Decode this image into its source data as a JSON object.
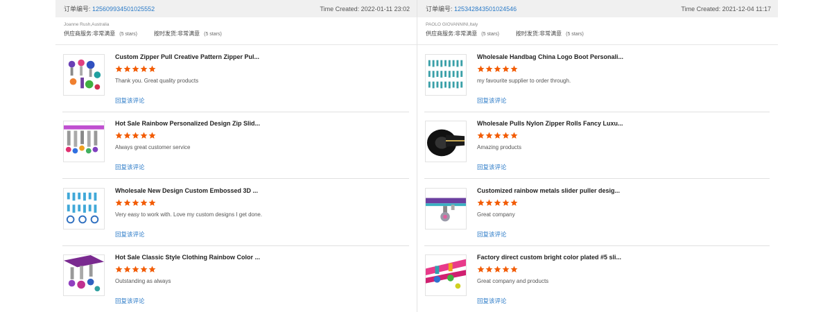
{
  "orders": [
    {
      "id_label": "订单编号:",
      "id": "125609934501025552",
      "time_created": "Time Created: 2022-01-11 23:02",
      "buyer": "Joanne Rush,Australia",
      "ratings": [
        {
          "label": "供应商服务:",
          "value": "非常满意",
          "stars": "(5 stars)"
        },
        {
          "label": "按时发货:",
          "value": "非常满意",
          "stars": "(5 stars)"
        }
      ],
      "reviews": [
        {
          "title": "Custom Zipper Pull Creative Pattern Zipper Pul...",
          "comment": "Thank you. Great quality products",
          "reply": "回复该评论",
          "rating": 5
        },
        {
          "title": "Hot Sale Rainbow Personalized Design Zip Slid...",
          "comment": "Always great customer service",
          "reply": "回复该评论",
          "rating": 5
        },
        {
          "title": "Wholesale New Design Custom Embossed 3D ...",
          "comment": "Very easy to work with. Love my custom designs I get done.",
          "reply": "回复该评论",
          "rating": 5
        },
        {
          "title": "Hot Sale Classic Style Clothing Rainbow Color ...",
          "comment": "Outstanding as always",
          "reply": "回复该评论",
          "rating": 5
        }
      ]
    },
    {
      "id_label": "订单编号:",
      "id": "125342843501024546",
      "time_created": "Time Created: 2021-12-04 11:17",
      "buyer": "PAOLO GIOVANNINI,Italy",
      "ratings": [
        {
          "label": "供应商服务:",
          "value": "非常满意",
          "stars": "(5 stars)"
        },
        {
          "label": "按时发货:",
          "value": "非常满意",
          "stars": "(5 stars)"
        }
      ],
      "reviews": [
        {
          "title": "Wholesale Handbag China Logo Boot Personali...",
          "comment": "my favourite supplier to order through.",
          "reply": "回复该评论",
          "rating": 5
        },
        {
          "title": "Wholesale Pulls Nylon Zipper Rolls Fancy Luxu...",
          "comment": "Amazing products",
          "reply": "回复该评论",
          "rating": 5
        },
        {
          "title": "Customized rainbow metals slider puller desig...",
          "comment": "Great company",
          "reply": "回复该评论",
          "rating": 5
        },
        {
          "title": "Factory direct custom bright color plated #5 sli...",
          "comment": "Great company and products",
          "reply": "回复该评论",
          "rating": 5
        }
      ]
    }
  ],
  "colors": {
    "link": "#2a7ac7",
    "star": "#f25c05",
    "header_bg": "#f0f0f0"
  },
  "icons": {
    "star": "star-icon"
  }
}
